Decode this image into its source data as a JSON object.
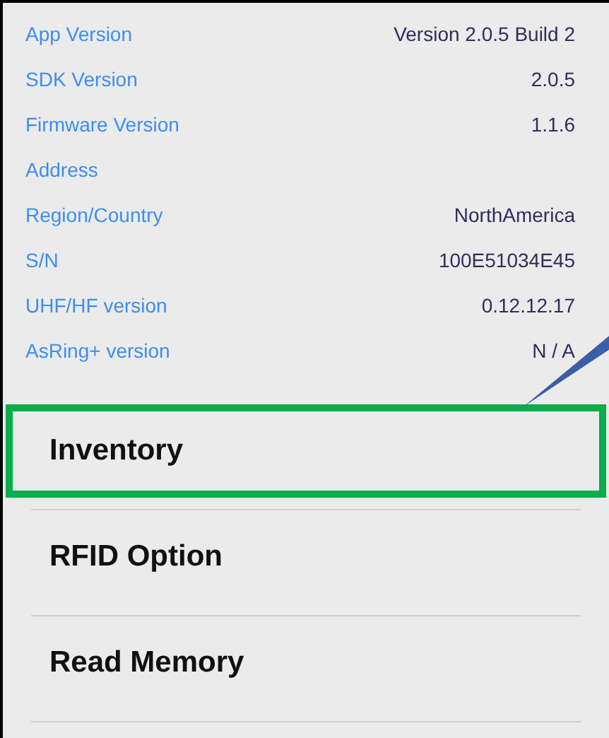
{
  "info_rows": [
    {
      "label": "App Version",
      "value": "Version 2.0.5 Build 2"
    },
    {
      "label": "SDK Version",
      "value": "2.0.5"
    },
    {
      "label": "Firmware Version",
      "value": "1.1.6"
    },
    {
      "label": "Address"
    },
    {
      "label": "Region/Country",
      "value": "NorthAmerica"
    },
    {
      "label": "S/N",
      "value": "100E51034E45"
    },
    {
      "label": "UHF/HF version",
      "value": "0.12.12.17"
    },
    {
      "label": "AsRing+ version",
      "value": "N / A"
    }
  ],
  "menu_items": [
    {
      "label": "Inventory",
      "highlighted": true
    },
    {
      "label": "RFID Option",
      "highlighted": false
    },
    {
      "label": "Read Memory",
      "highlighted": false
    }
  ]
}
